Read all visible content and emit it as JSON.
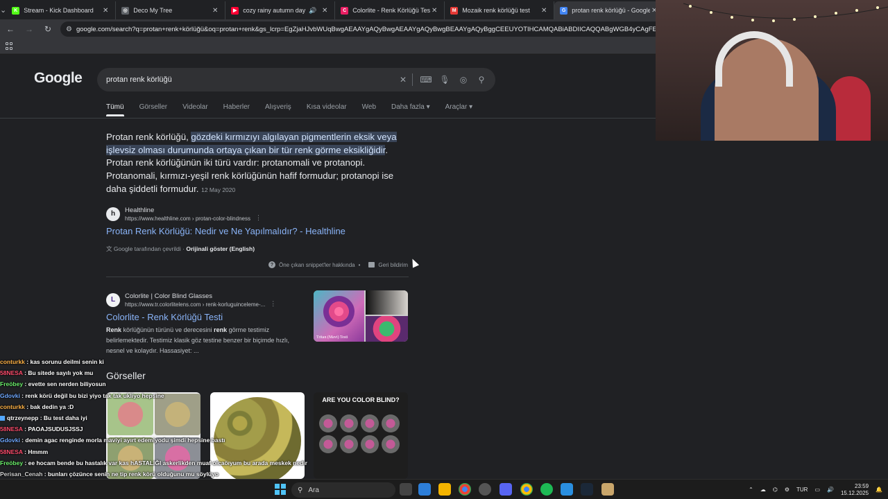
{
  "browser": {
    "tabs": [
      {
        "title": "Stream - Kick Dashboard",
        "fav_color": "#53fc18",
        "fav_glyph": "K"
      },
      {
        "title": "Deco My Tree",
        "fav_color": "#5f6368",
        "fav_glyph": "◎"
      },
      {
        "title": "cozy rainy autumn day",
        "fav_color": "#ff0033",
        "fav_glyph": "▶"
      },
      {
        "title": "Colorlite - Renk Körlüğü Testi",
        "fav_color": "#e91e63",
        "fav_glyph": "C"
      },
      {
        "title": "Mozaik renk körlüğü test",
        "fav_color": "#e53935",
        "fav_glyph": "M"
      },
      {
        "title": "protan renk körlüğü - Google",
        "fav_color": "#4285f4",
        "fav_glyph": "G"
      }
    ],
    "url": "google.com/search?q=protan+renk+körlüğü&oq=protan+renk&gs_lcrp=EgZjaHJvbWUqBwgAEAAYgAQyBwgAEAAYgAQyBwgBEAAYgAQyBggCEEUYOTIHCAMQABiABDIICAQQABgWGB4yCAgFEAAYFhgeMgoIBhAAGA"
  },
  "google": {
    "logo": "Google",
    "query": "protan renk körlüğü",
    "tabs": [
      "Tümü",
      "Görseller",
      "Videolar",
      "Haberler",
      "Alışveriş",
      "Kısa videolar",
      "Web",
      "Daha fazla ▾",
      "Araçlar ▾"
    ],
    "snippet": {
      "lead": "Protan renk körlüğü, ",
      "highlight": "gözdeki kırmızıyı algılayan pigmentlerin eksik veya işlevsiz olması durumunda ortaya çıkan bir tür renk görme eksikliğidir",
      "rest": ". Protan renk körlüğünün iki türü vardır: protanomali ve protanopi. Protanomali, kırmızı-yeşil renk körlüğünün hafif formudur; protanopi ise daha şiddetli formudur.",
      "date": "12 May 2020"
    },
    "source1": {
      "name": "Healthline",
      "url": "https://www.healthline.com › protan-color-blindness",
      "title": "Protan Renk Körlüğü: Nedir ve Ne Yapılmalıdır? - Healthline"
    },
    "translate_note": "Google tarafından çevrildi",
    "translate_original": "Orijinali göster (English)",
    "about": "Öne çıkan snippet'ler hakkında",
    "feedback": "Geri bildirim",
    "source2": {
      "name": "Colorlite | Color Blind Glasses",
      "url": "https://www.tr.colorlitelens.com › renk-korluguinceleme-...",
      "title": "Colorlite - Renk Körlüğü Testi",
      "desc_b1": "Renk",
      "desc_1": " körlüğünün türünü ve derecesini ",
      "desc_b2": "renk",
      "desc_2": " görme testimiz belirlemektedir. Testimiz klasik göz testine benzer bir biçimde hızlı, nesnel ve kolaydır. Hassasiyet: ...",
      "thumb_label": "Tritan (Mavi) Testi"
    },
    "images_title": "Görseller",
    "image3_heading": "ARE YOU COLOR BLIND?"
  },
  "chat": [
    {
      "user": "conturkk",
      "color": "#ffb347",
      "msg": "kas sorunu deilmi senin ki"
    },
    {
      "user": "58NESA",
      "color": "#ff4d6d",
      "msg": "Bu sitede sayılı yok mu"
    },
    {
      "user": "Freöbey",
      "color": "#6cf06c",
      "msg": "evette sen nerden biliyosun"
    },
    {
      "user": "Gdovki",
      "color": "#6fa8ff",
      "msg": "renk körü değil bu bizi yiyo tak tak ukliyo hepsine"
    },
    {
      "user": "conturkk",
      "color": "#ffb347",
      "msg": "bak dedin ya :D"
    },
    {
      "user": "qtrzeynepp",
      "color": "#ffffff",
      "msg": "Bu test daha iyi"
    },
    {
      "user": "58NESA",
      "color": "#ff4d6d",
      "msg": "PAOAJSUDUSJSSJ"
    },
    {
      "user": "Gdovki",
      "color": "#6fa8ff",
      "msg": "demin agac renginde morla maviyi ayırt edemiyodu şimdi hepsine bastı"
    },
    {
      "user": "58NESA",
      "color": "#ff4d6d",
      "msg": "Hmmm"
    },
    {
      "user": "Freöbey",
      "color": "#6cf06c",
      "msg": "ee hocam bende bu hastalık var kas hASTALIĞI askerlikden muaf olcaöıyum bu arada meskek nedir"
    },
    {
      "user": "Perisan_Cenah",
      "color": "#d0d0d0",
      "msg": "bunları çözünce senin ne tip renk körü olduğunu mu söylüyo"
    }
  ],
  "taskbar": {
    "search": "Ara",
    "lang": "TUR",
    "time": "23:59",
    "date": "15.12.2025"
  }
}
